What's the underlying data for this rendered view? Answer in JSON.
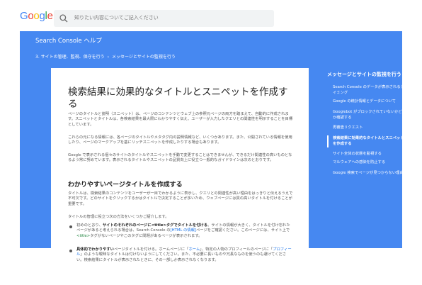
{
  "header": {
    "logo_text": "Google",
    "logo_colors": [
      "#4285f4",
      "#ea4335",
      "#fbbc05",
      "#4285f4",
      "#34a853",
      "#ea4335"
    ],
    "search_placeholder": "知りたい内容についてご記入ください",
    "search_icon": "search-icon"
  },
  "band": {
    "color": "#4688f1",
    "help_title": "Search Console ヘルプ",
    "breadcrumb": [
      "3. サイトの管理、監視、保守を行う",
      "メッセージとサイトの監視を行う"
    ],
    "breadcrumb_separator": "›"
  },
  "article": {
    "title": "検索結果に効果的なタイトルとスニペットを作成する",
    "p1": "ページのタイトルと説明（スニペット）は、ページのコンテンツとウェブ上の参照元ページの両方を踏まえて、自動的に作成されます。スニペットとタイトルは、各検索結果を最大限にわかりやすく伝え、ユーザーが入力したクエリとの関連性を明示することを目標としています。",
    "p2": "これらの元になる情報には、各ページのタイトルやメタタグ内の説明情報など、いくつかあります。また、公開されている情報を使用したり、ページのマークアップを基にリッチスニペットを作成したりする場合もあります。",
    "p3": "Google で表示される個々のサイトのタイトルやスニペットを手動で変更することはできませんが、できるだけ関連性の高いものとなるよう常に努めています。表示されるタイトルやスニペットの品質向上に役立つ一般的なガイドラインは次のとおりです。",
    "h2": "わかりやすいページタイトルを作成する",
    "p4": "タイトルは、検索結果のコンテンツをユーザーが一目でわかるように表示し、クエリとの関連性が高い理由をはっきりと伝えるうえで不可欠です。どのサイトをクリックするかはタイトルで決定することが多いため、ウェブページには質の高いタイトルを付けることが重要です。",
    "p5": "タイトルの管理に役立つ次の方法をいくつかご紹介します。",
    "b1_prefix": "初めのとおり、",
    "b1_bold": "サイトのそれぞれのページに",
    "b1_code": "<title>",
    "b1_bold2": "タグでタイトルを付ける",
    "b1_rest": "。サイトの情報が大きく、タイトルを付け忘れたページがあると考えられる場合は、Search Console の",
    "b1_link": "[HTML の情報]",
    "b1_rest2": "ページをご確認ください。このページには、サイト上で",
    "b1_code2": "<title>",
    "b1_rest3": "タグがないページやこのタグに問題があるページが表示されます。",
    "b2_bold": "具体的でわかりやすい",
    "b2_rest": "ページタイトルを付ける。ホームページに「",
    "b2_link": "ホーム",
    "b2_rest2": "」、特定の人物のプロフィールのページに「",
    "b2_link2": "プロフィール",
    "b2_rest3": "」のような曖昧なタイトルは付けないようにしてください。また、不必要に長いものや冗長なものを使うのも避けてください。検索結果にタイトルが表示されたときに、その一部しか表示されなくなります。"
  },
  "sidebar": {
    "title": "メッセージとサイトの監視を行う",
    "items": [
      "Search Console のデータが表示されるタイミング",
      "Google の統計情報とデータについて",
      "Googlebot がブロックされていないかどうか確認する",
      "再審査リクエスト",
      "検索結果に効果的なタイトルとスニペットを作成する",
      "サイト全体の状態を監視する",
      "マルウェアへの感染を防止する",
      "Google 検索でページが見つからない理由"
    ],
    "active_index": 4
  }
}
